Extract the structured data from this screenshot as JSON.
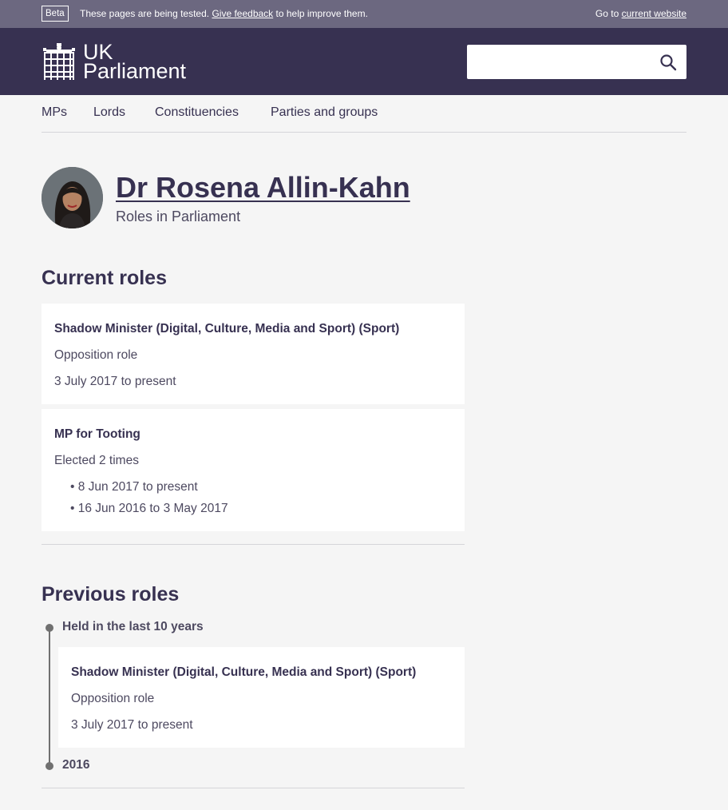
{
  "beta_bar": {
    "tag": "Beta",
    "message_before": "These pages are being tested.",
    "feedback_link": "Give feedback",
    "message_after": "to help improve them.",
    "goto_prefix": "Go to",
    "current_website_link": "current website"
  },
  "header": {
    "logo_line1": "UK",
    "logo_line2": "Parliament",
    "search": {
      "placeholder": "",
      "value": "",
      "icon": "search-icon"
    }
  },
  "nav": {
    "items": [
      "MPs",
      "Lords",
      "Constituencies",
      "Parties and groups"
    ]
  },
  "person": {
    "name": "Dr Rosena Allin-Kahn",
    "subtitle": "Roles in Parliament"
  },
  "current_roles": {
    "heading": "Current roles",
    "cards": [
      {
        "title": "Shadow Minister (Digital, Culture, Media and Sport) (Sport)",
        "type": "Opposition role",
        "dates": "3 July 2017 to present"
      },
      {
        "title": "MP for Tooting",
        "subtitle": "Elected 2 times",
        "terms": [
          "• 8 Jun 2017 to present",
          "• 16 Jun 2016 to 3 May 2017"
        ]
      }
    ]
  },
  "previous_roles": {
    "heading": "Previous roles",
    "groups": [
      {
        "label": "Held in the last 10 years",
        "card": {
          "title": "Shadow Minister (Digital, Culture, Media and Sport) (Sport)",
          "type": "Opposition role",
          "dates": "3 July 2017 to present"
        }
      },
      {
        "label": "2016"
      }
    ]
  },
  "colors": {
    "primary": "#373151",
    "beta_bar": "#6c6880",
    "background": "#f5f5f5",
    "card": "#ffffff"
  }
}
